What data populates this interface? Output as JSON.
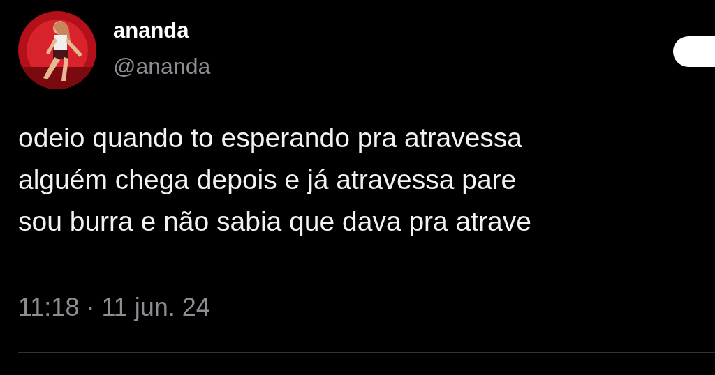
{
  "author": {
    "name": "ananda",
    "handle": "@ananda"
  },
  "tweet": {
    "lines": [
      "odeio quando to esperando pra atravessa",
      "alguém chega depois e já atravessa pare",
      "sou burra e não sabia que dava pra atrave"
    ],
    "timestamp": "11:18 · 11 jun. 24"
  }
}
